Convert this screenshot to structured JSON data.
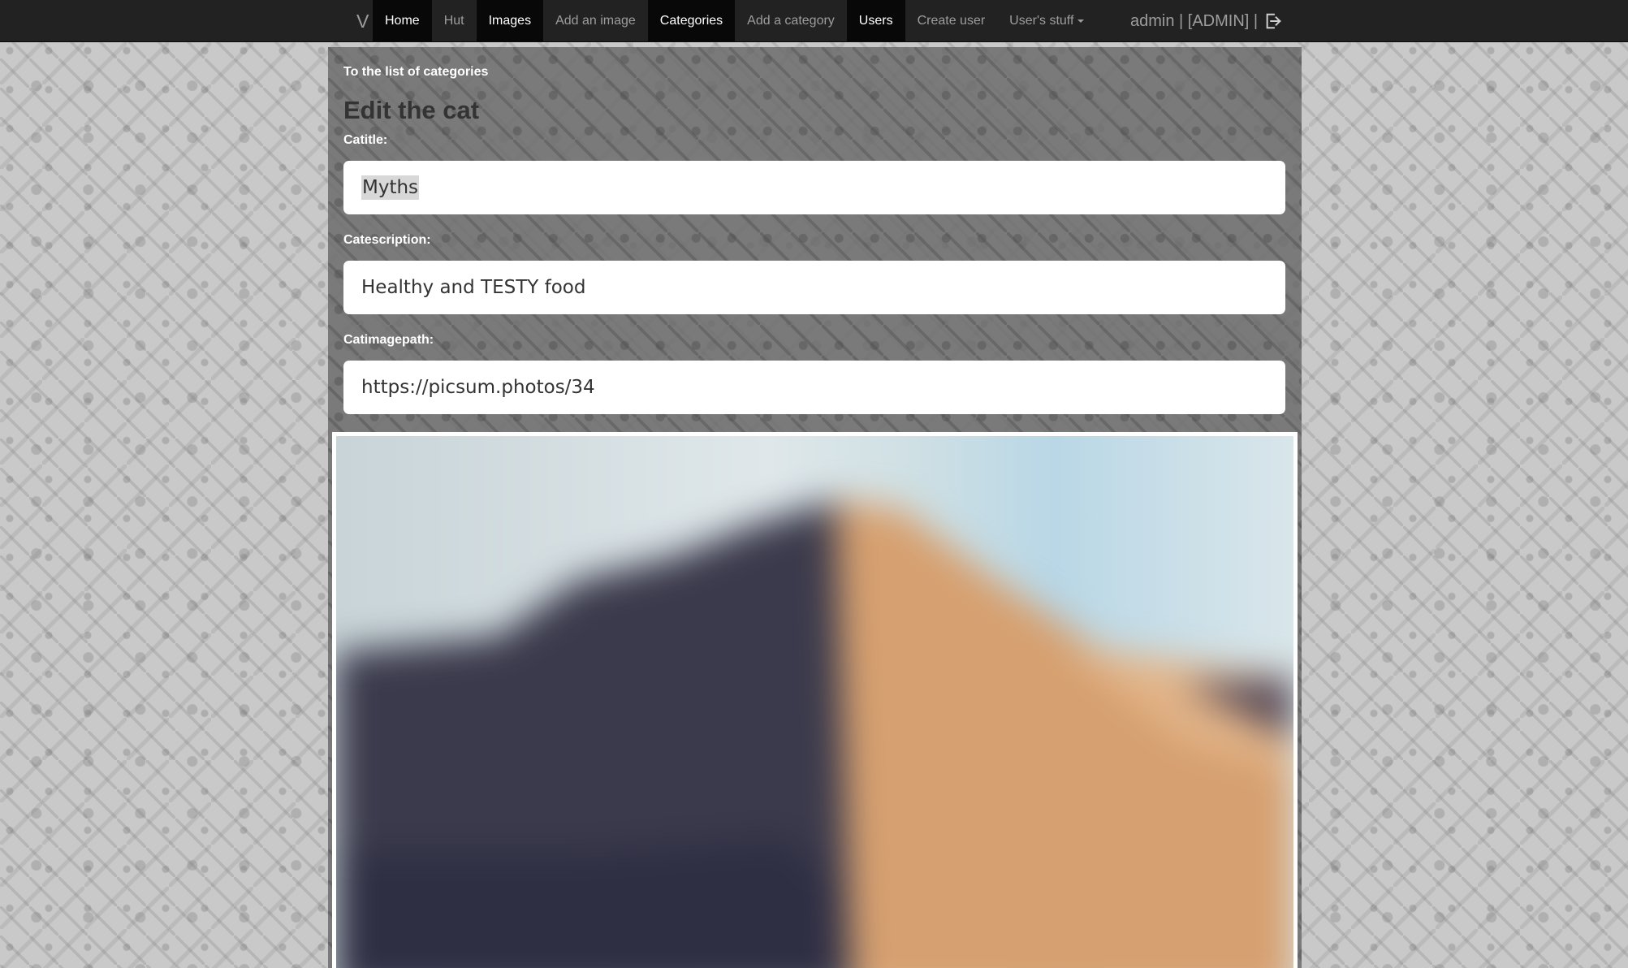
{
  "navbar": {
    "brand": "V",
    "items": [
      {
        "label": "Home",
        "active": true
      },
      {
        "label": "Hut",
        "active": false
      },
      {
        "label": "Images",
        "active": true
      },
      {
        "label": "Add an image",
        "active": false
      },
      {
        "label": "Categories",
        "active": true
      },
      {
        "label": "Add a category",
        "active": false
      },
      {
        "label": "Users",
        "active": true
      },
      {
        "label": "Create user",
        "active": false
      },
      {
        "label": "User's stuff",
        "active": false,
        "dropdown": true
      }
    ],
    "user_text": "admin | [ADMIN] |",
    "logout_icon": "logout-icon"
  },
  "page": {
    "back_link": "To the list of categories",
    "title": "Edit the cat"
  },
  "form": {
    "title_label": "Catitle:",
    "title_value": "Myths",
    "description_label": "Catescription:",
    "description_value": "Healthy and TESTY food",
    "imagepath_label": "Catimagepath:",
    "imagepath_value": "https://picsum.photos/34"
  },
  "colors": {
    "navbar_bg": "#222222",
    "active_nav_bg": "#080808",
    "panel_bg": "#6b6b6b",
    "page_bg": "#c9c9c9"
  }
}
